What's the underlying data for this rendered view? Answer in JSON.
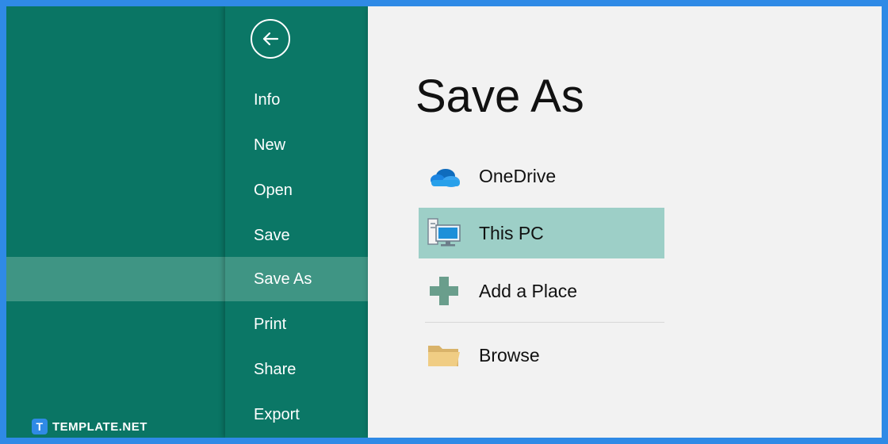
{
  "nav": {
    "back_icon": "back-arrow-icon",
    "items": [
      {
        "label": "Info"
      },
      {
        "label": "New"
      },
      {
        "label": "Open"
      },
      {
        "label": "Save"
      },
      {
        "label": "Save As",
        "active": true
      },
      {
        "label": "Print"
      },
      {
        "label": "Share"
      },
      {
        "label": "Export"
      }
    ]
  },
  "main": {
    "title": "Save As",
    "locations": [
      {
        "label": "OneDrive",
        "icon": "onedrive-cloud-icon"
      },
      {
        "label": "This PC",
        "icon": "this-pc-icon",
        "selected": true
      },
      {
        "label": "Add a Place",
        "icon": "plus-icon"
      },
      {
        "label": "Browse",
        "icon": "folder-icon"
      }
    ]
  },
  "watermark": {
    "logo_letter": "T",
    "text": "TEMPLATE.NET"
  },
  "colors": {
    "frame_border": "#2f8ae6",
    "nav_background": "#0a7564",
    "nav_active": "#3f9584",
    "content_background": "#f2f2f2",
    "selected_location": "#9dcfc7"
  }
}
